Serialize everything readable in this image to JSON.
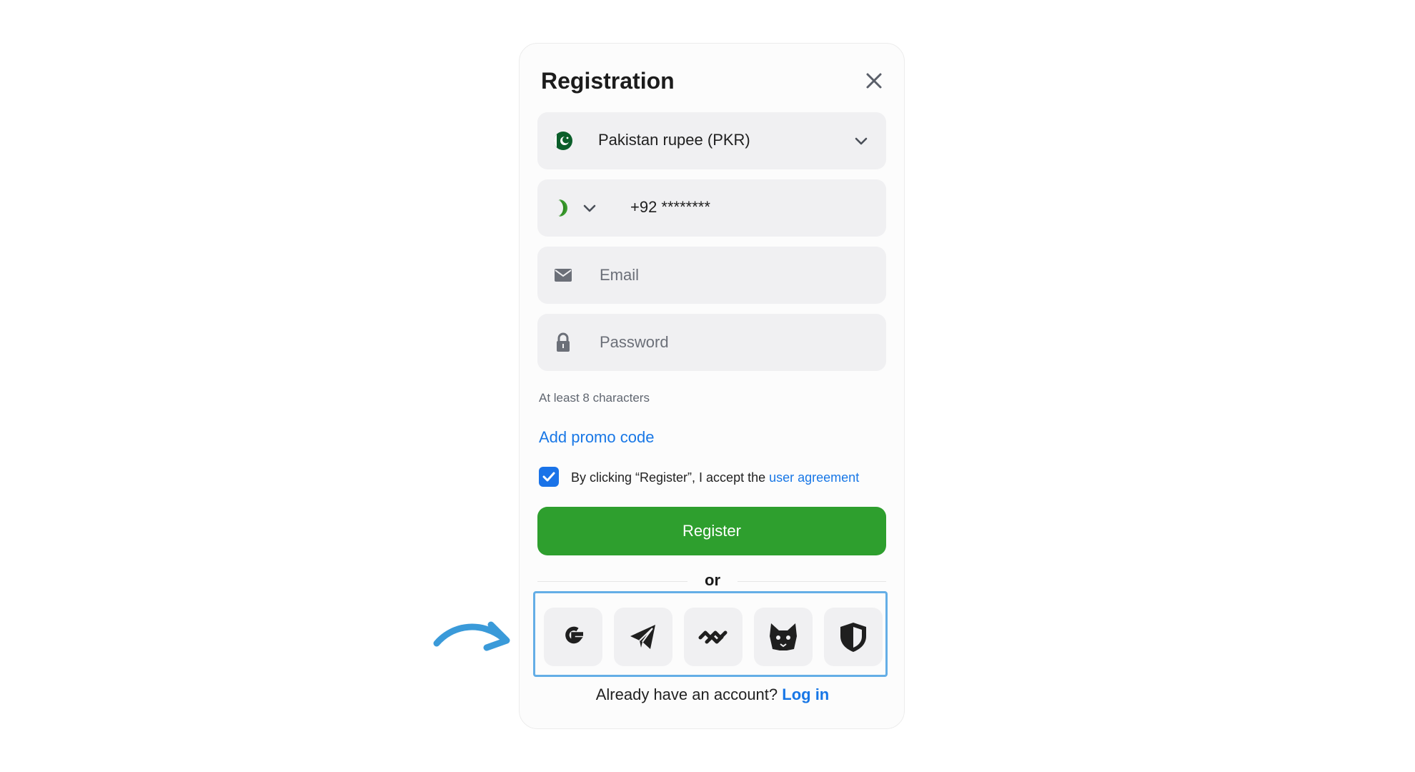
{
  "modal": {
    "title": "Registration",
    "currency": {
      "value": "Pakistan rupee (PKR)",
      "flag_icon": "pakistan-flag-icon"
    },
    "phone": {
      "value": "+92 ********",
      "flag_icon": "pakistan-crescent-icon"
    },
    "email": {
      "placeholder": "Email",
      "icon": "envelope-icon"
    },
    "password": {
      "placeholder": "Password",
      "icon": "lock-icon",
      "hint": "At least 8 characters"
    },
    "promo_label": "Add promo code",
    "agreement": {
      "text": "By clicking “Register”, I accept the",
      "link": "user agreement",
      "checked": true
    },
    "register_label": "Register",
    "divider_label": "or",
    "social": [
      {
        "name": "google",
        "icon": "google-icon"
      },
      {
        "name": "telegram",
        "icon": "telegram-icon"
      },
      {
        "name": "walletconnect",
        "icon": "walletconnect-icon"
      },
      {
        "name": "metamask",
        "icon": "fox-icon"
      },
      {
        "name": "shield",
        "icon": "shield-icon"
      }
    ],
    "login": {
      "prompt": "Already have an account?",
      "link": "Log in"
    }
  },
  "colors": {
    "accent_blue": "#1877e6",
    "register_green": "#2e9f2e",
    "highlight_box": "#64aee6",
    "field_bg": "#f0f0f2"
  }
}
